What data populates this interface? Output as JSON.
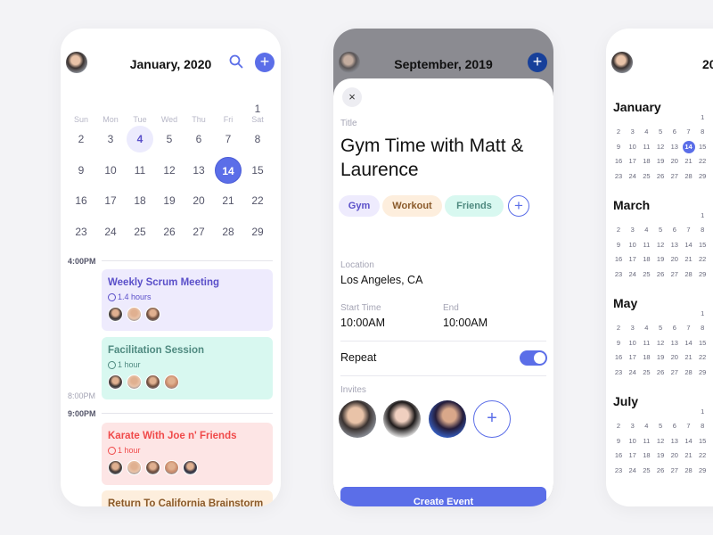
{
  "colors": {
    "accent": "#5b6ee8",
    "purple_card": "#eeebfd",
    "teal_card": "#d8f8f0",
    "red_card": "#fde5e5",
    "orange_card": "#fdeedd"
  },
  "calendar": {
    "title": "January, 2020",
    "weekdays": [
      "Sun",
      "Mon",
      "Tue",
      "Wed",
      "Thu",
      "Fri",
      "Sat"
    ],
    "weeks": [
      [
        "",
        "",
        "",
        "",
        "",
        "",
        "1"
      ],
      [
        "2",
        "3",
        "4",
        "5",
        "6",
        "7",
        "8"
      ],
      [
        "9",
        "10",
        "11",
        "12",
        "13",
        "14",
        "15"
      ],
      [
        "16",
        "17",
        "18",
        "19",
        "20",
        "21",
        "22"
      ],
      [
        "23",
        "24",
        "25",
        "26",
        "27",
        "28",
        "29"
      ]
    ],
    "selected_day": "4",
    "today": "14",
    "times": [
      "4:00PM",
      "8:00PM",
      "9:00PM"
    ],
    "events": [
      {
        "title": "Weekly Scrum Meeting",
        "duration": "1.4 hours",
        "attendees": 3
      },
      {
        "title": "Facilitation Session",
        "duration": "1 hour",
        "attendees": 4
      },
      {
        "title": "Karate With Joe n' Friends",
        "duration": "1 hour",
        "attendees": 5
      },
      {
        "title": "Return To California Brainstorm"
      }
    ]
  },
  "new_event": {
    "background_title": "September, 2019",
    "close_icon": "×",
    "title_label": "Title",
    "title_value": "Gym Time with Matt & Laurence",
    "tags": [
      "Gym",
      "Workout",
      "Friends"
    ],
    "location_label": "Location",
    "location_value": "Los Angeles, CA",
    "start_label": "Start Time",
    "start_value": "10:00AM",
    "end_label": "End",
    "end_value": "10:00AM",
    "repeat_label": "Repeat",
    "repeat_on": true,
    "invites_label": "Invites",
    "create_button": "Create Event"
  },
  "year_view": {
    "title": "20",
    "months": [
      {
        "name": "January",
        "today": "14"
      },
      {
        "name": "March"
      },
      {
        "name": "May"
      },
      {
        "name": "July"
      }
    ]
  }
}
